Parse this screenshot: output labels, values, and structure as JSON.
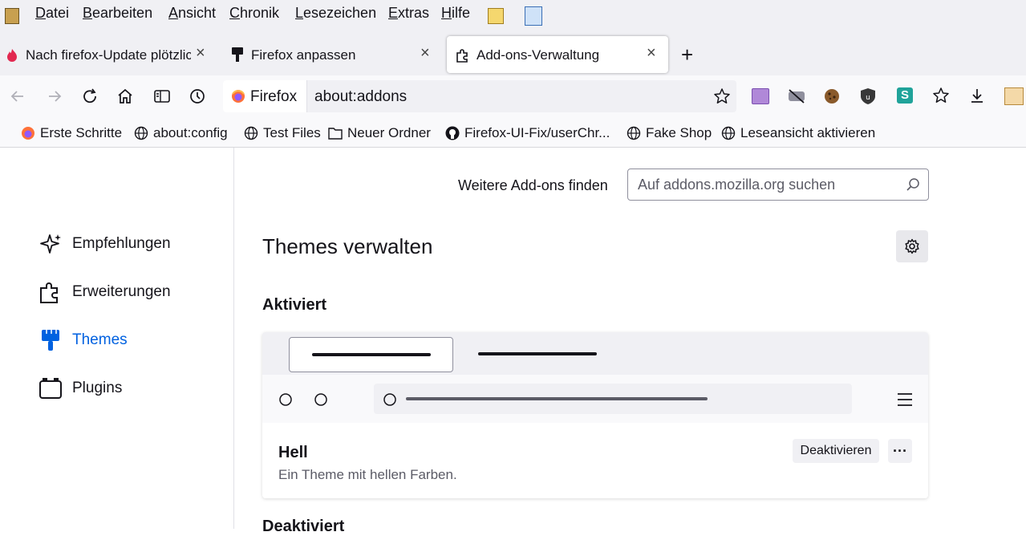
{
  "menubar": {
    "items": [
      {
        "label": "Datei",
        "accel": "D",
        "rest": "atei"
      },
      {
        "label": "Bearbeiten",
        "accel": "B",
        "rest": "earbeiten"
      },
      {
        "label": "Ansicht",
        "accel": "A",
        "rest": "nsicht"
      },
      {
        "label": "Chronik",
        "accel": "C",
        "rest": "hronik"
      },
      {
        "label": "Lesezeichen",
        "accel": "L",
        "rest": "esezeichen"
      },
      {
        "label": "Extras",
        "accel": "E",
        "rest": "xtras"
      },
      {
        "label": "Hilfe",
        "accel": "H",
        "rest": "ilfe"
      }
    ]
  },
  "tabs": [
    {
      "label": "Nach firefox-Update plötzlich",
      "icon": "flame-icon",
      "close": "×"
    },
    {
      "label": "Firefox anpassen",
      "icon": "paintbrush-icon",
      "close": "×"
    },
    {
      "label": "Add-ons-Verwaltung",
      "icon": "puzzle-icon",
      "close": "×",
      "active": true
    }
  ],
  "new_tab": "+",
  "urlbar": {
    "identity": "Firefox",
    "url": "about:addons"
  },
  "bookmarks": [
    {
      "label": "Erste Schritte",
      "icon": "firefox-icon"
    },
    {
      "label": "about:config",
      "icon": "globe-icon"
    },
    {
      "label": "Test Files",
      "icon": "globe-icon"
    },
    {
      "label": "Neuer Ordner",
      "icon": "folder-icon"
    },
    {
      "label": "Firefox-UI-Fix/userChr...",
      "icon": "github-icon"
    },
    {
      "label": "Fake Shop",
      "icon": "globe-icon"
    },
    {
      "label": "Leseansicht aktivieren",
      "icon": "globe-icon"
    }
  ],
  "sidebar": {
    "items": [
      {
        "label": "Empfehlungen",
        "icon": "sparkle-icon"
      },
      {
        "label": "Erweiterungen",
        "icon": "puzzle-icon"
      },
      {
        "label": "Themes",
        "icon": "brush-icon",
        "selected": true
      },
      {
        "label": "Plugins",
        "icon": "plugin-icon"
      }
    ]
  },
  "main": {
    "find_label": "Weitere Add-ons finden",
    "search_placeholder": "Auf addons.mozilla.org suchen",
    "title": "Themes verwalten",
    "section_active": "Aktiviert",
    "section_inactive": "Deaktiviert",
    "theme": {
      "name": "Hell",
      "description": "Ein Theme mit hellen Farben.",
      "deactivate_label": "Deaktivieren",
      "more_label": "···"
    }
  },
  "colors": {
    "accent": "#0061e0",
    "toolbar": "#f9f9fb",
    "tabstrip": "#f0f0f4"
  }
}
